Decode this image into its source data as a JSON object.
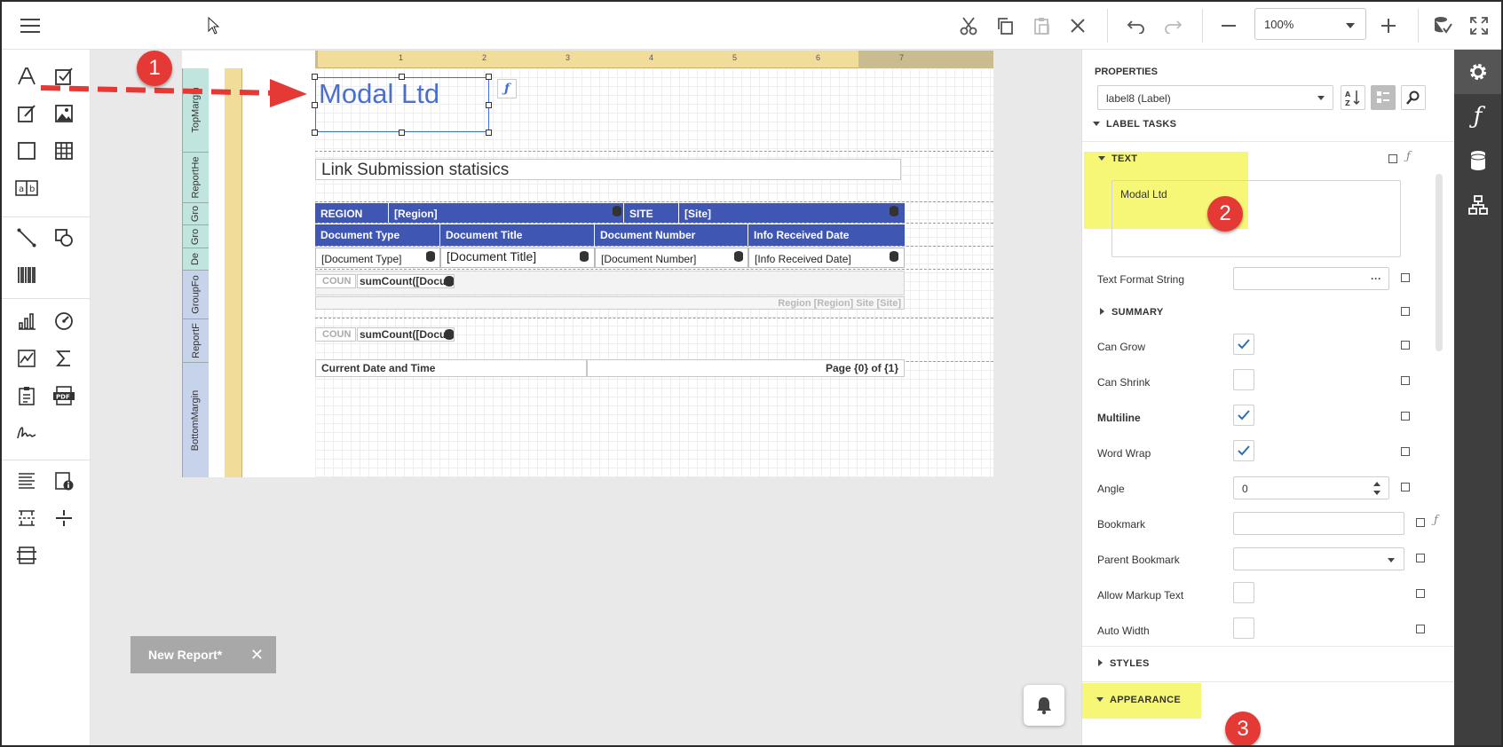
{
  "toolbar": {
    "zoom_value": "100%"
  },
  "report": {
    "bands": [
      "TopMargin",
      "ReportHe",
      "Gro",
      "Gro",
      "De",
      "GroupFo",
      "ReportF",
      "BottomMargin"
    ],
    "ruler_ticks": [
      "1",
      "2",
      "3",
      "4",
      "5",
      "6",
      "7"
    ],
    "company_label": "Modal Ltd",
    "report_title": "Link Submission statisics",
    "group_header": {
      "region_label": "REGION",
      "region_field": "[Region]",
      "site_label": "SITE",
      "site_field": "[Site]"
    },
    "columns": [
      "Document Type",
      "Document Title",
      "Document Number",
      "Info Received Date"
    ],
    "detail_fields": [
      "[Document Type]",
      "[Document Title]",
      "[Document Number]",
      "[Info Received Date]"
    ],
    "group_footer": {
      "count_label": "COUN",
      "count_expr": "sumCount([Docum",
      "region_site_text": "Region [Region] Site [Site]"
    },
    "report_footer": {
      "count_label": "COUN",
      "count_expr": "sumCount([Docum"
    },
    "bottom": {
      "date_label": "Current Date and Time",
      "page_label": "Page {0} of {1}"
    }
  },
  "properties": {
    "header": "PROPERTIES",
    "selected_component": "label8 (Label)",
    "sections": {
      "label_tasks": "LABEL TASKS",
      "text": "TEXT",
      "summary": "SUMMARY",
      "styles": "STYLES",
      "appearance": "APPEARANCE"
    },
    "text_value": "Modal Ltd",
    "fields": {
      "text_format_string": "Text Format String",
      "can_grow": "Can Grow",
      "can_shrink": "Can Shrink",
      "multiline": "Multiline",
      "word_wrap": "Word Wrap",
      "angle": "Angle",
      "angle_value": "0",
      "bookmark": "Bookmark",
      "parent_bookmark": "Parent Bookmark",
      "allow_markup_text": "Allow Markup Text",
      "auto_width": "Auto Width"
    },
    "ellipsis": "···"
  },
  "annotations": [
    "1",
    "2",
    "3"
  ],
  "report_tab": {
    "label": "New Report*",
    "close": "✕"
  },
  "glyphs": {
    "fx": "ƒ"
  },
  "colors": {
    "header_blue": "#3f57b3",
    "annotation_red": "#e53935",
    "highlight_yellow": "#f5f555",
    "ruler": "#f2dc9a"
  }
}
